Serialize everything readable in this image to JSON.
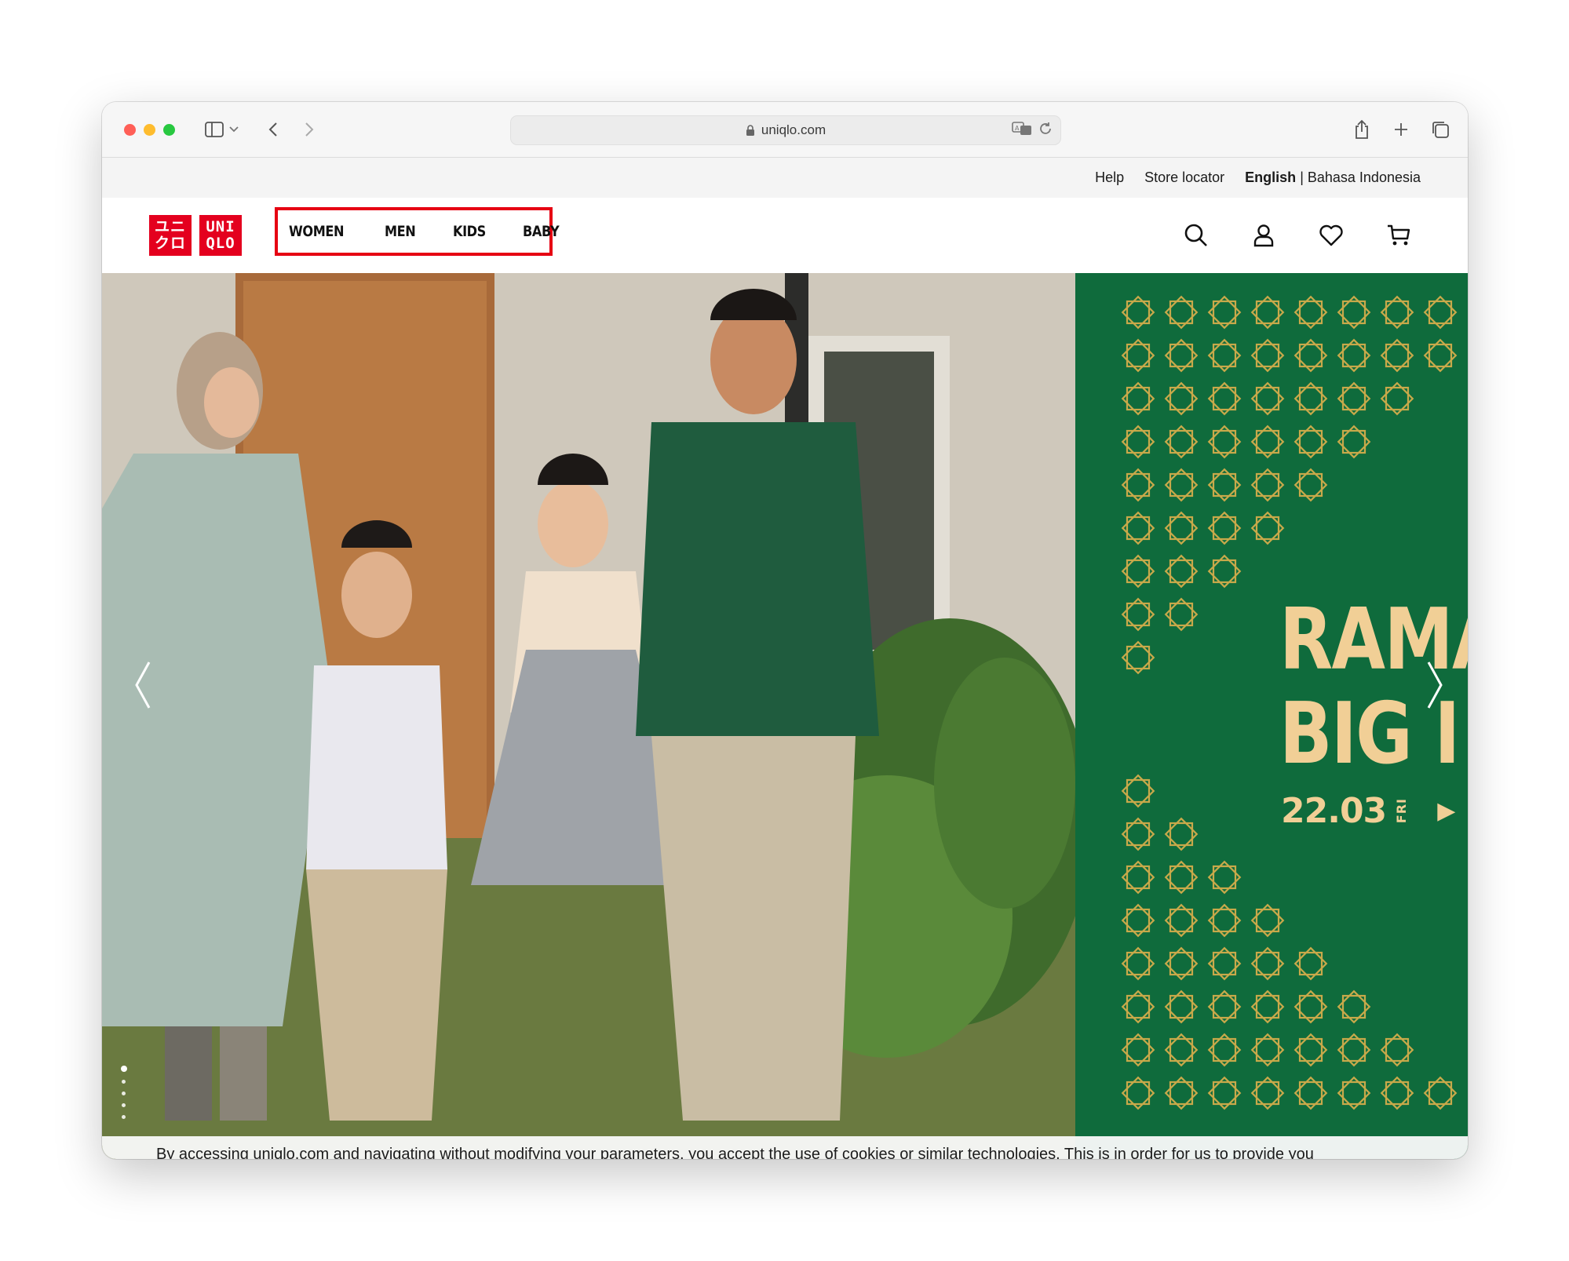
{
  "browser": {
    "url": "uniqlo.com"
  },
  "utility_bar": {
    "help": "Help",
    "store_locator": "Store locator",
    "lang_english": "English",
    "separator": "|",
    "lang_bahasa": "Bahasa Indonesia"
  },
  "logo": {
    "left_glyph_top": "ユニ",
    "left_glyph_bottom": "クロ",
    "right_top": "UNI",
    "right_bottom": "QLO",
    "brand_color": "#e4001e"
  },
  "nav": {
    "items": [
      {
        "label": "WOMEN"
      },
      {
        "label": "MEN"
      },
      {
        "label": "KIDS"
      },
      {
        "label": "BABY"
      }
    ],
    "highlight_color": "#e60012"
  },
  "header_icons": [
    "search-icon",
    "account-icon",
    "wishlist-heart-icon",
    "cart-icon"
  ],
  "hero": {
    "promo_line1": "RAMA",
    "promo_line2": "BIG I",
    "promo_date": "22.03",
    "promo_day": "FRI",
    "promo_arrow": "▶",
    "panel_color": "#0f6b3c",
    "text_color": "#f1cf96",
    "slides_count": 5,
    "active_slide": 1
  },
  "cookie_banner": {
    "text": "By accessing uniqlo.com and navigating without modifying your parameters, you accept the use of cookies or similar technologies. This is in order for us to provide you with the best services and offers adapted to your interests. But most importantly, a more secure experience on our website. For more information, please check our Privacy Policy."
  }
}
